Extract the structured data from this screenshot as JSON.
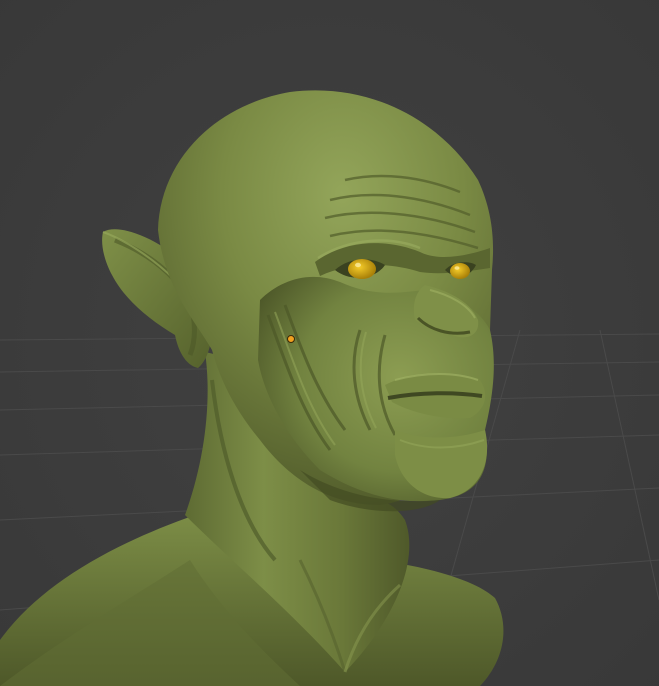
{
  "viewport": {
    "background_color": "#3d3d3d",
    "grid_color": "#4a4a4a",
    "model": {
      "kind": "sculpted-creature-bust",
      "skin_color": "#6f7d3e",
      "skin_highlight": "#93a55a",
      "skin_shadow": "#475025",
      "eye_color": "#d8a80d"
    },
    "origin_marker_color": "#f0a020"
  }
}
